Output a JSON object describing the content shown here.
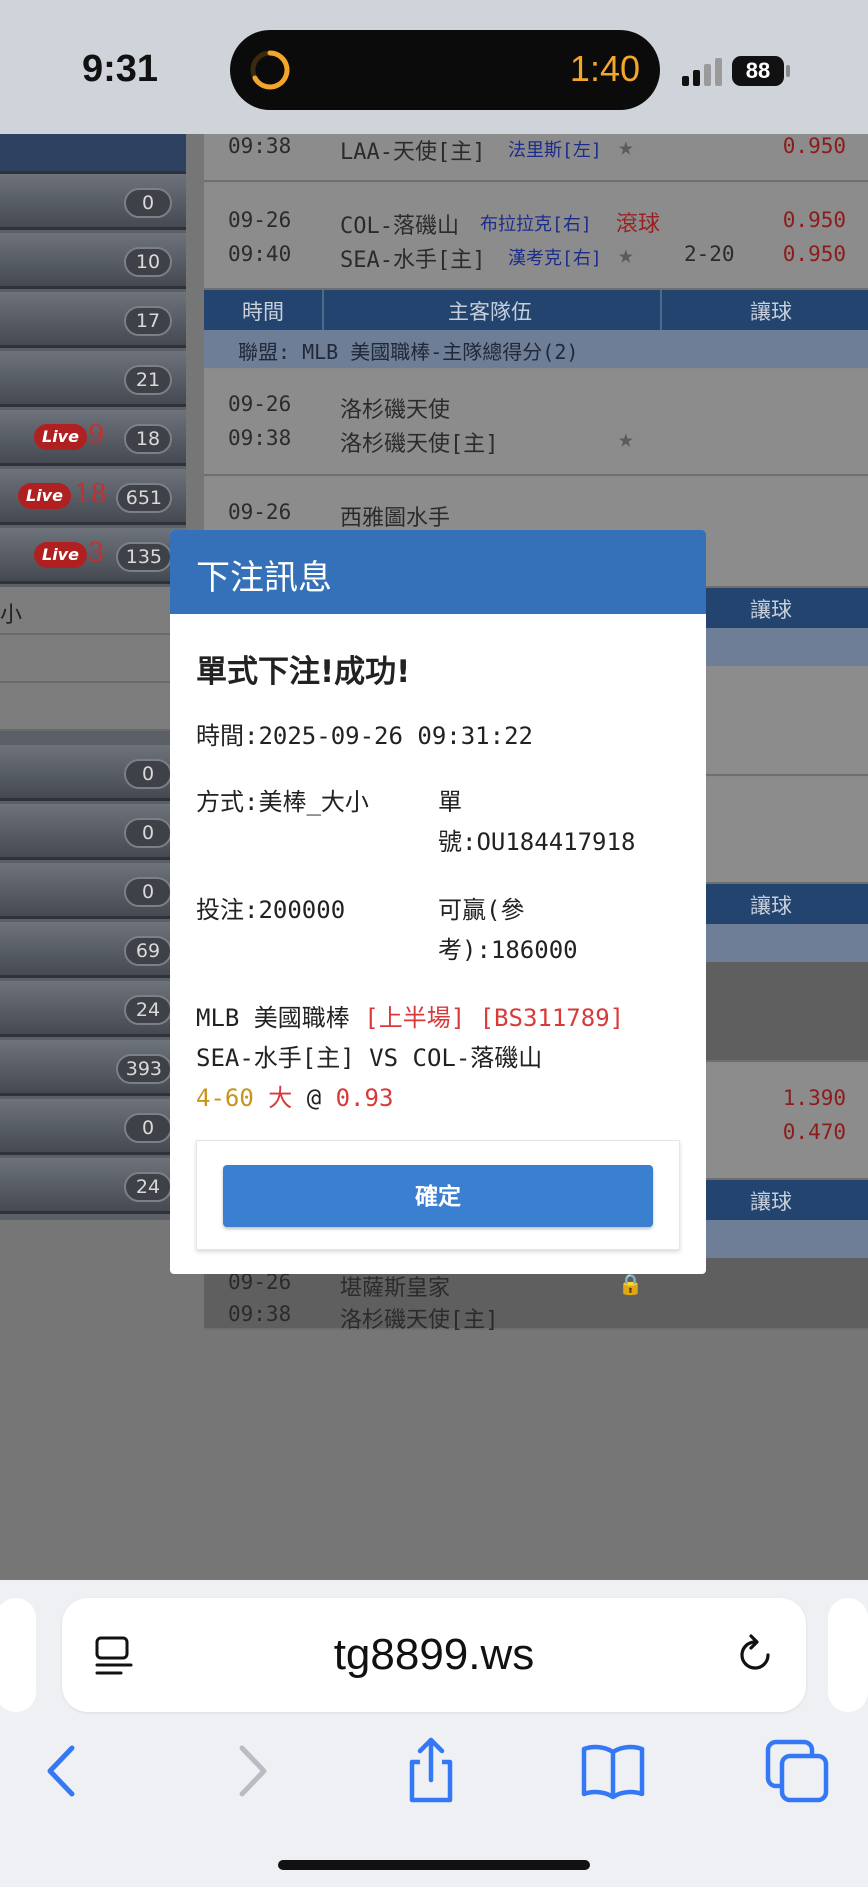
{
  "status_bar": {
    "time": "9:31",
    "timer": "1:40",
    "battery": "88"
  },
  "sidebar": {
    "badges": [
      "0",
      "10",
      "17",
      "21",
      "18",
      "651",
      "135",
      "0",
      "0",
      "0",
      "69",
      "24",
      "393",
      "0",
      "24"
    ],
    "live_label": "Live",
    "live_counts": [
      "9",
      "18",
      "3"
    ],
    "text_fragment": "小"
  },
  "content": {
    "match_top": {
      "time": "09:38",
      "team": "LAA-天使[主]",
      "pitcher": "法里斯[左]",
      "odds": "0.950"
    },
    "match_2": {
      "date": "09-26",
      "time": "09:40",
      "away": "COL-落磯山",
      "away_pitcher": "布拉拉克[右]",
      "home": "SEA-水手[主]",
      "home_pitcher": "漢考克[右]",
      "rolling": "滾球",
      "handicap": "2-20",
      "odds1": "0.950",
      "odds2": "0.950"
    },
    "table_header": {
      "col_time": "時間",
      "col_teams": "主客隊伍",
      "col_handicap": "讓球"
    },
    "league_label": "聯盟: MLB 美國職棒-主隊總得分(2)",
    "match_3": {
      "date": "09-26",
      "time": "09:38",
      "line1": "洛杉磯天使",
      "line2": "洛杉磯天使[主]"
    },
    "match_4": {
      "date": "09-26",
      "line1": "西雅圖水手"
    },
    "odds_mid": [
      "1.390",
      "0.470"
    ],
    "match_last": {
      "date": "09-26",
      "time": "09:38",
      "line1": "堪薩斯皇家",
      "line2": "洛杉磯天使[主]"
    }
  },
  "modal": {
    "title": "下注訊息",
    "success": "單式下注!成功!",
    "time_line": "時間:2025-09-26 09:31:22",
    "method": "方式:美棒_大小",
    "ticket_label": "單",
    "ticket_value": "號:OU184417918",
    "stake": "投注:200000",
    "win_label": "可贏(參",
    "win_value": "考):186000",
    "league": "MLB 美國職棒",
    "half": "[上半場]",
    "code": "[BS311789]",
    "teams": "SEA-水手[主] VS COL-落磯山",
    "line": "4-60",
    "pick": "大",
    "at": "@",
    "odds": "0.93",
    "confirm": "確定"
  },
  "browser": {
    "url": "tg8899.ws"
  }
}
